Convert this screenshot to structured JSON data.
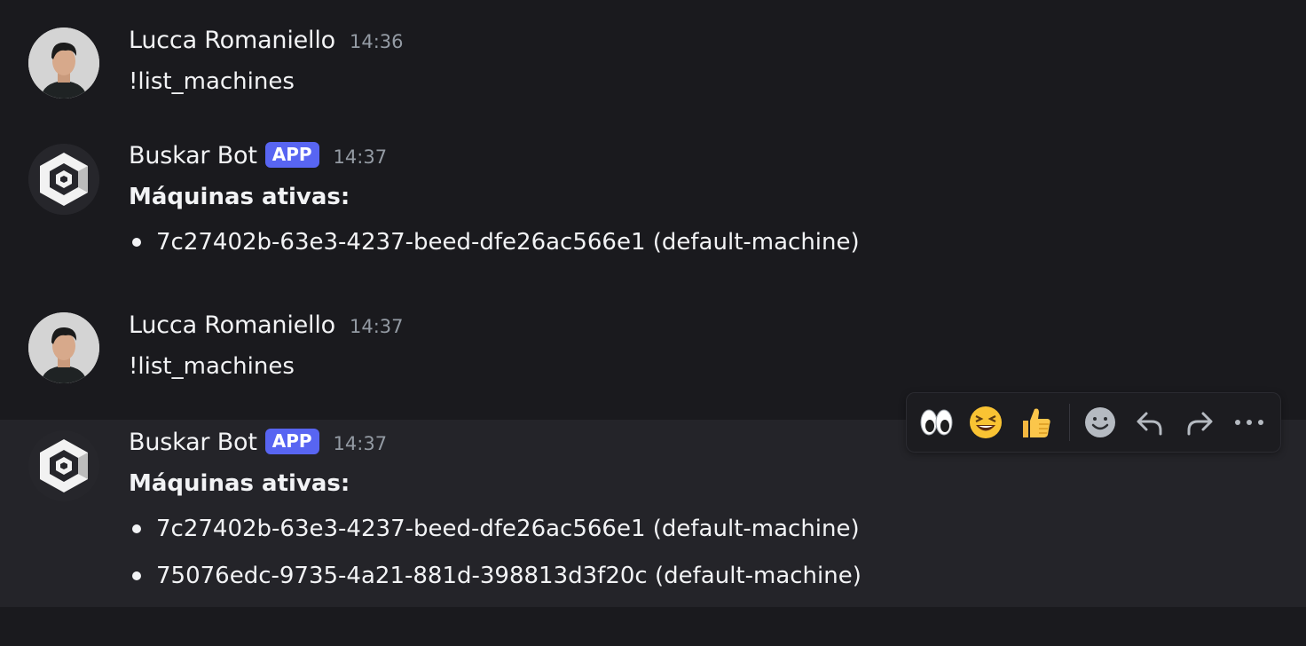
{
  "messages": [
    {
      "author": "Lucca Romaniello",
      "time": "14:36",
      "text": "!list_machines",
      "avatar": "user-avatar-photo"
    },
    {
      "author": "Buskar Bot",
      "badge": "APP",
      "time": "14:37",
      "heading": "Máquinas ativas:",
      "items": [
        "7c27402b-63e3-4237-beed-dfe26ac566e1 (default-machine)"
      ],
      "avatar": "bot-hexagon-logo"
    },
    {
      "author": "Lucca Romaniello",
      "time": "14:37",
      "text": "!list_machines",
      "avatar": "user-avatar-photo"
    },
    {
      "author": "Buskar Bot",
      "badge": "APP",
      "time": "14:37",
      "heading": "Máquinas ativas:",
      "items": [
        "7c27402b-63e3-4237-beed-dfe26ac566e1 (default-machine)",
        "75076edc-9735-4a21-881d-398813d3f20c (default-machine)"
      ],
      "avatar": "bot-hexagon-logo"
    }
  ],
  "toolbar": {
    "reactions": [
      "👀",
      "😆",
      "👍"
    ],
    "actions": [
      "add-reaction-icon",
      "reply-icon",
      "forward-icon",
      "more-icon"
    ]
  },
  "colors": {
    "background": "#1a1a1e",
    "hover_background": "#242429",
    "app_badge": "#5865f2",
    "timestamp": "#949ba4"
  }
}
